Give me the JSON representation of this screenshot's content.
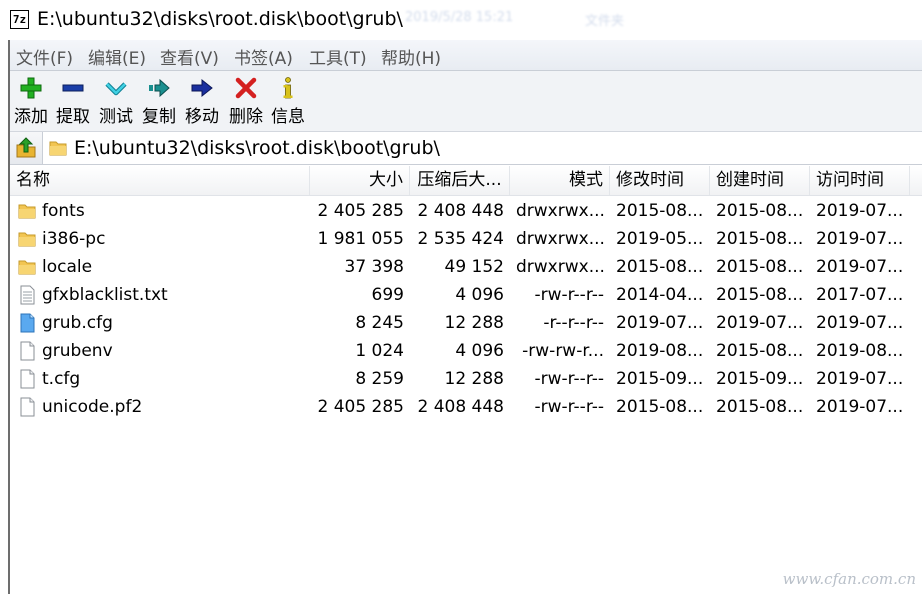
{
  "window": {
    "icon_text": "7z",
    "title": "E:\\ubuntu32\\disks\\root.disk\\boot\\grub\\",
    "blurred_title_date": "2019/5/28 15:21",
    "blurred_title_extra": "文件夹"
  },
  "menu": [
    {
      "label": "文件(F)"
    },
    {
      "label": "编辑(E)"
    },
    {
      "label": "查看(V)"
    },
    {
      "label": "书签(A)"
    },
    {
      "label": "工具(T)"
    },
    {
      "label": "帮助(H)"
    }
  ],
  "toolbar": [
    {
      "label": "添加",
      "icon": "add-icon",
      "color": "#22b022"
    },
    {
      "label": "提取",
      "icon": "extract-icon",
      "color": "#1a3ea8"
    },
    {
      "label": "测试",
      "icon": "test-icon",
      "color": "#1fb2c9"
    },
    {
      "label": "复制",
      "icon": "copy-icon",
      "color": "#1a8f8f"
    },
    {
      "label": "移动",
      "icon": "move-icon",
      "color": "#1a2f9e"
    },
    {
      "label": "删除",
      "icon": "delete-icon",
      "color": "#d42020"
    },
    {
      "label": "信息",
      "icon": "info-icon",
      "color": "#d8c21a"
    }
  ],
  "address": {
    "path": "E:\\ubuntu32\\disks\\root.disk\\boot\\grub\\"
  },
  "columns": {
    "name": "名称",
    "size": "大小",
    "packed": "压缩后大...",
    "mode": "模式",
    "modified": "修改时间",
    "created": "创建时间",
    "accessed": "访问时间"
  },
  "files": [
    {
      "name": "fonts",
      "type": "folder",
      "size": "2 405 285",
      "packed": "2 408 448",
      "mode": "drwxrwx...",
      "modified": "2015-08...",
      "created": "2015-08...",
      "accessed": "2019-07..."
    },
    {
      "name": "i386-pc",
      "type": "folder",
      "size": "1 981 055",
      "packed": "2 535 424",
      "mode": "drwxrwx...",
      "modified": "2019-05...",
      "created": "2015-08...",
      "accessed": "2019-07..."
    },
    {
      "name": "locale",
      "type": "folder",
      "size": "37 398",
      "packed": "49 152",
      "mode": "drwxrwx...",
      "modified": "2015-08...",
      "created": "2015-08...",
      "accessed": "2019-07..."
    },
    {
      "name": "gfxblacklist.txt",
      "type": "text",
      "size": "699",
      "packed": "4 096",
      "mode": "-rw-r--r--",
      "modified": "2014-04...",
      "created": "2015-08...",
      "accessed": "2017-07..."
    },
    {
      "name": "grub.cfg",
      "type": "cfg",
      "size": "8 245",
      "packed": "12 288",
      "mode": "-r--r--r--",
      "modified": "2019-07...",
      "created": "2019-07...",
      "accessed": "2019-07..."
    },
    {
      "name": "grubenv",
      "type": "file",
      "size": "1 024",
      "packed": "4 096",
      "mode": "-rw-rw-r...",
      "modified": "2019-08...",
      "created": "2015-08...",
      "accessed": "2019-08..."
    },
    {
      "name": "t.cfg",
      "type": "file",
      "size": "8 259",
      "packed": "12 288",
      "mode": "-rw-r--r--",
      "modified": "2015-09...",
      "created": "2015-09...",
      "accessed": "2019-07..."
    },
    {
      "name": "unicode.pf2",
      "type": "file",
      "size": "2 405 285",
      "packed": "2 408 448",
      "mode": "-rw-r--r--",
      "modified": "2015-08...",
      "created": "2015-08...",
      "accessed": "2019-07..."
    }
  ],
  "watermark": "www.cfan.com.cn"
}
